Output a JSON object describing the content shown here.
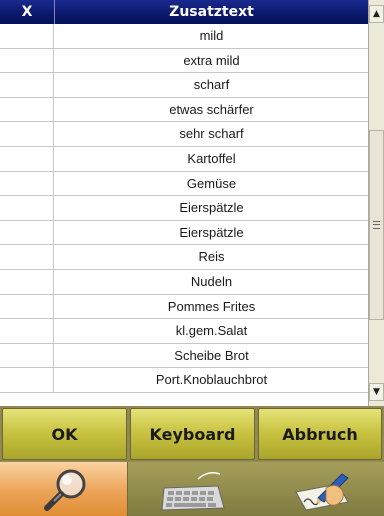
{
  "table": {
    "header": {
      "col_x": "X",
      "col_text": "Zusatztext"
    },
    "rows": [
      "mild",
      "extra mild",
      "scharf",
      "etwas schärfer",
      "sehr scharf",
      "Kartoffel",
      "Gemüse",
      "Eierspätzle",
      "Eierspätzle",
      "Reis",
      "Nudeln",
      "Pommes Frites",
      "kl.gem.Salat",
      "Scheibe Brot",
      "Port.Knoblauchbrot"
    ]
  },
  "scrollbar": {
    "up_glyph": "▲",
    "down_glyph": "▼",
    "grip_glyph": "≡"
  },
  "buttons": {
    "ok": "OK",
    "keyboard": "Keyboard",
    "cancel": "Abbruch"
  },
  "tabs": [
    {
      "icon": "magnifier-icon",
      "active": true
    },
    {
      "icon": "keyboard-icon",
      "active": false
    },
    {
      "icon": "handwriting-icon",
      "active": false
    }
  ],
  "colors": {
    "header_bg": "#0b196d",
    "button_yellow": "#c9c442",
    "tab_active": "#eba458",
    "tab_bg": "#8f8a55"
  }
}
